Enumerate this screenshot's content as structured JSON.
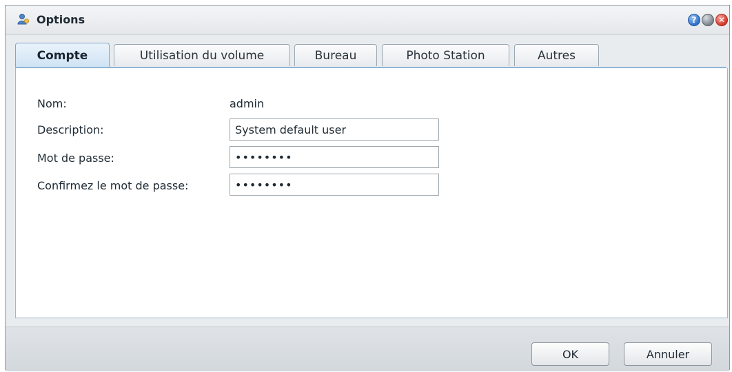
{
  "window": {
    "title": "Options",
    "icon": "user-settings-icon",
    "controls": {
      "help": "?",
      "minimize": "",
      "close": "✕"
    }
  },
  "tabs": [
    {
      "label": "Compte",
      "active": true
    },
    {
      "label": "Utilisation du volume",
      "active": false
    },
    {
      "label": "Bureau",
      "active": false
    },
    {
      "label": "Photo Station",
      "active": false
    },
    {
      "label": "Autres",
      "active": false
    }
  ],
  "account": {
    "name_label": "Nom:",
    "name_value": "admin",
    "description_label": "Description:",
    "description_value": "System default user",
    "password_label": "Mot de passe:",
    "password_value": "••••••••",
    "confirm_label": "Confirmez le mot de passe:",
    "confirm_value": "••••••••"
  },
  "footer": {
    "ok_label": "OK",
    "cancel_label": "Annuler"
  },
  "colors": {
    "accent": "#8fb5d6",
    "active_tab": "#cfe3f4",
    "help_button": "#2e6fc9",
    "close_button": "#d33a2c"
  }
}
